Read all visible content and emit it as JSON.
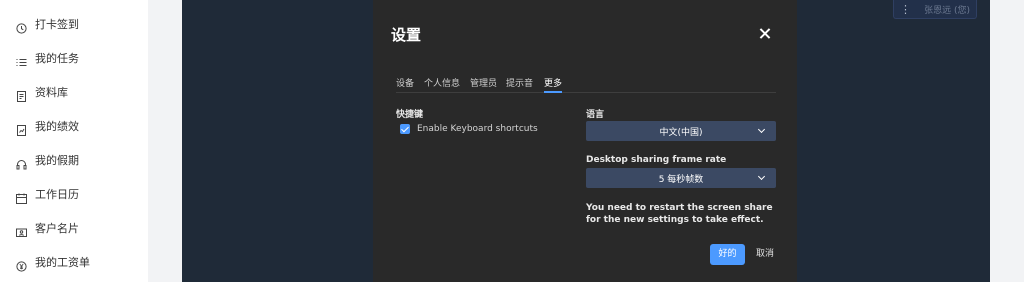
{
  "sidebar": {
    "items": [
      {
        "label": "打卡签到",
        "icon": "clock-icon"
      },
      {
        "label": "我的任务",
        "icon": "list-icon"
      },
      {
        "label": "资料库",
        "icon": "document-icon"
      },
      {
        "label": "我的绩效",
        "icon": "report-icon"
      },
      {
        "label": "我的假期",
        "icon": "headphones-icon"
      },
      {
        "label": "工作日历",
        "icon": "calendar-icon"
      },
      {
        "label": "客户名片",
        "icon": "id-card-icon"
      },
      {
        "label": "我的工资单",
        "icon": "currency-icon"
      }
    ]
  },
  "participant": {
    "name": "张恩远 (您)",
    "menu_icon": "more-vertical-icon"
  },
  "modal": {
    "title": "设置",
    "tabs": [
      "设备",
      "个人信息",
      "管理员",
      "提示音",
      "更多"
    ],
    "active_tab": "更多",
    "shortcuts": {
      "title": "快捷键",
      "checkbox_label": "Enable Keyboard shortcuts",
      "checked": true
    },
    "language": {
      "title": "语言",
      "value": "中文(中国)"
    },
    "framerate": {
      "title": "Desktop sharing frame rate",
      "value": "5 每秒帧数"
    },
    "note": "You need to restart the screen share for the new settings to take effect.",
    "ok_label": "好的",
    "cancel_label": "取消"
  },
  "colors": {
    "accent": "#4c9aff",
    "modal_bg": "#292929",
    "stage_bg": "#1f2a38",
    "select_bg": "#3b4963"
  }
}
